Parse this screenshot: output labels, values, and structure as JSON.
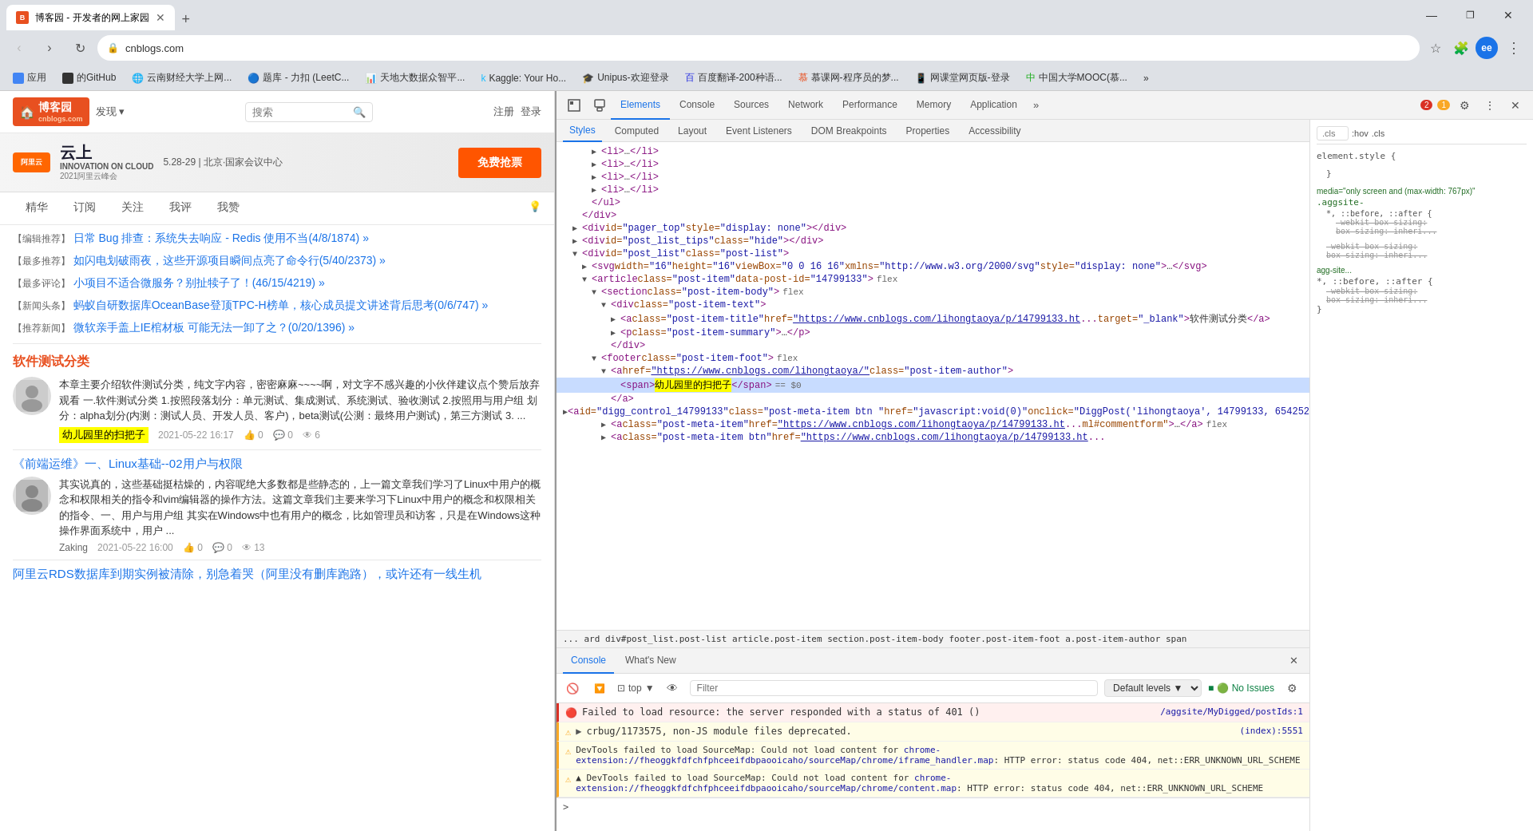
{
  "browser": {
    "tab_title": "博客园 - 开发者的网上家园",
    "tab_favicon_text": "B",
    "new_tab_label": "+",
    "address": "cnblogs.com",
    "window_controls": [
      "—",
      "❐",
      "✕"
    ]
  },
  "bookmarks": [
    {
      "label": "应用",
      "favicon_color": "#4285f4"
    },
    {
      "label": "的GitHub",
      "favicon_color": "#333"
    },
    {
      "label": "云南财经大学上网...",
      "favicon_color": "#1a73e8"
    },
    {
      "label": "题库 - 力扣 (LeetC...",
      "favicon_color": "#f0a30a"
    },
    {
      "label": "天地大数据众智平...",
      "favicon_color": "#1a73e8"
    },
    {
      "label": "Kaggle: Your Ho...",
      "favicon_color": "#20beff"
    },
    {
      "label": "Unipus-欢迎登录",
      "favicon_color": "#005bac"
    },
    {
      "label": "百度翻译-200种语...",
      "favicon_color": "#2932e1"
    },
    {
      "label": "慕课网-程序员的梦...",
      "favicon_color": "#e85020"
    },
    {
      "label": "网课堂网页版-登录",
      "favicon_color": "#0066cc"
    },
    {
      "label": "中国大学MOOC(慕...",
      "favicon_color": "#1aad19"
    }
  ],
  "page": {
    "logo_text": "博客园",
    "logo_subtext": "cnblogs.com",
    "discover_label": "发现 ▾",
    "search_placeholder": "搜索",
    "register_label": "注册",
    "login_label": "登录",
    "nav_items": [
      "精华",
      "订阅",
      "关注",
      "我评",
      "我赞"
    ],
    "banner": {
      "logo_text": "阿里云",
      "cloud_text": "云上",
      "innovation_text": "INNOVATION\nON CLOUD",
      "event_name": "2021阿里云峰会",
      "date_text": "5.28-29 | 北京·国家会议中心",
      "btn_text": "免费抢票"
    },
    "posts": [
      {
        "tag": "【编辑推荐】",
        "title": "日常 Bug 排查：系统失去响应 - Redis 使用不当(4/8/1874) »",
        "type": "editorial"
      },
      {
        "tag": "【最多推荐】",
        "title": "如闪电划破雨夜，这些开源项目瞬间点亮了命令行(5/40/2373) »",
        "type": "most_recommended"
      },
      {
        "tag": "【最多评论】",
        "title": "小项目不适合微服务？别扯犊子了！(46/15/4219) »",
        "type": "most_commented"
      },
      {
        "tag": "【新闻头条】",
        "title": "蚂蚁自研数据库OceanBase登顶TPC-H榜单，核心成员提文讲述背后思考(0/6/747) »",
        "type": "news"
      },
      {
        "tag": "【推荐新闻】",
        "title": "微软亲手盖上IE棺材板 可能无法一卸了之？(0/20/1396) »",
        "type": "recommended_news"
      }
    ],
    "section_title": "软件测试分类",
    "article1": {
      "text": "本章主要介绍软件测试分类，纯文字内容，密密麻麻~~~~啊，对文字不感兴趣的小伙伴建议点个赞后放弃观看 一.软件测试分类 1.按照段落划分：单元测试、集成测试、系统测试、验收测试 2.按照用与用户组 划分：alpha划分(内测：测试人员、开发人员、客户)，beta测试(公测：最终用户测试)，第三方测试 3. ...",
      "author_highlighted": "幼儿园里的扫把子",
      "date": "2021-05-22 16:17",
      "likes": "0",
      "comments": "0",
      "views": "6"
    },
    "article2": {
      "title": "《前端运维》一、Linux基础--02用户与权限",
      "text": "其实说真的，这些基础挺枯燥的，内容呢绝大多数都是些静态的，上一篇文章我们学习了Linux中用户的概念和权限相关的指令和vim编辑器的操作方法。这篇文章我们主要来学习下Linux中用户的概念和权限相关的指令、一、用户与用户组 其实在Windows中也有用户的概念，比如管理员和访客，只是在Windows这种操作界面系统中，用户 ...",
      "author": "Zaking",
      "date": "2021-05-22 16:00",
      "likes": "0",
      "comments": "0",
      "views": "13"
    },
    "article3": {
      "title": "阿里云RDS数据库到期实例被清除，别急着哭（阿里没有删库跑路），或许还有一线生机"
    }
  },
  "devtools": {
    "tabs": [
      "Elements",
      "Console",
      "Sources",
      "Network",
      "Performance",
      "Memory",
      "Application"
    ],
    "active_tab": "Elements",
    "more_label": "»",
    "error_count": "2",
    "warn_count": "1",
    "close_label": "✕",
    "icons": {
      "inspect": "⬚",
      "device": "▭",
      "settings": "⚙",
      "more": "⋮"
    },
    "dom": {
      "lines": [
        {
          "indent": 3,
          "content": "<li>…</li>",
          "expanded": false
        },
        {
          "indent": 3,
          "content": "<li>…</li>",
          "expanded": false
        },
        {
          "indent": 3,
          "content": "<li>…</li>",
          "expanded": false
        },
        {
          "indent": 3,
          "content": "<li>…</li>",
          "expanded": false
        },
        {
          "indent": 2,
          "content": "</ul>",
          "expanded": false
        },
        {
          "indent": 1,
          "content": "</div>",
          "expanded": false
        },
        {
          "indent": 1,
          "html": "div_pager_top",
          "expanded": false
        },
        {
          "indent": 1,
          "html": "div_post_list_tips",
          "expanded": false
        },
        {
          "indent": 1,
          "html": "div_post_list_open",
          "expanded": true
        },
        {
          "indent": 2,
          "html": "svg",
          "expanded": false
        },
        {
          "indent": 2,
          "html": "article_open",
          "expanded": true
        },
        {
          "indent": 3,
          "html": "section_open",
          "expanded": true
        },
        {
          "indent": 4,
          "html": "div_post_item_text",
          "expanded": true
        },
        {
          "indent": 5,
          "html": "a_post_item_title",
          "expanded": false
        },
        {
          "indent": 5,
          "html": "p_post_item_summary",
          "expanded": false
        },
        {
          "indent": 4,
          "html": "div_close",
          "expanded": false
        },
        {
          "indent": 3,
          "html": "footer_open",
          "expanded": true
        },
        {
          "indent": 4,
          "html": "a_post_item_author",
          "expanded": true,
          "selected": false
        },
        {
          "indent": 5,
          "html": "span_highlighted",
          "selected": true
        },
        {
          "indent": 5,
          "html": "a_close",
          "expanded": false
        }
      ]
    },
    "breadcrumb": "... ard  div#post_list.post-list  article.post-item  section.post-item-body  footer.post-item-foot  a.post-item-author  span",
    "styles_tabs": [
      "Styles",
      "Computed",
      "Layout",
      "Event Listeners",
      "DOM Breakpoints",
      "Properties",
      "Accessibility"
    ],
    "active_style_tab": "Styles",
    "styles_filter_placeholder": ".cls",
    "styles_content": [
      {
        "selector": ":hov .cls",
        "source": "",
        "rules": []
      }
    ]
  },
  "console": {
    "tabs": [
      "Console",
      "What's New"
    ],
    "active_tab": "Console",
    "filter_placeholder": "Filter",
    "level_options": [
      "Default levels ▼"
    ],
    "no_issues_text": "🟢 No Issues",
    "messages": [
      {
        "type": "error",
        "text": "Failed to load resource: the server responded with a status of 401 ()",
        "source": "/aggsite/MyDigged/postIds:1",
        "expandable": false
      },
      {
        "type": "warning",
        "text": "▶ crbug/1173575, non-JS module files deprecated.",
        "source": "(index):5551",
        "expandable": true
      },
      {
        "type": "warning",
        "text": "DevTools failed to load SourceMap: Could not load content for chrome-extension://fheoggkfdfchfphceeifdbpaooicaho/sourceMap/chrome/iframe_handler.map: HTTP error: status code 404, net::ERR_UNKNOWN_URL_SCHEME",
        "source": "",
        "expandable": false
      },
      {
        "type": "warning",
        "text": "▲ DevTools failed to load SourceMap: Could not load content for chrome-extension://fheoggkfdfchfphceeifdbpaooicaho/sourceMap/chrome/content.map: HTTP error: status code 404, net::ERR_UNKNOWN_URL_SCHEME",
        "source": "",
        "expandable": false
      }
    ],
    "whats_new_title": "What's New"
  }
}
